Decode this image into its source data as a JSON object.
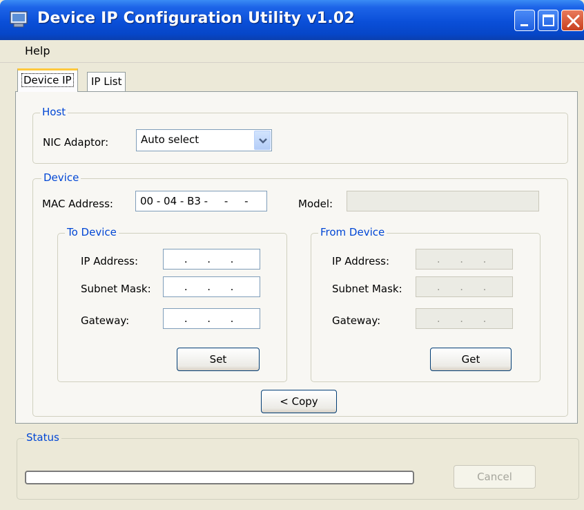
{
  "window": {
    "title": "Device IP Configuration Utility v1.02",
    "title_color": "#ffffff",
    "titlebar_color": "#0a4fd8"
  },
  "menu": {
    "items": [
      {
        "label": "Help"
      }
    ]
  },
  "tabs": [
    {
      "label": "Device IP",
      "active": true
    },
    {
      "label": "IP List",
      "active": false
    }
  ],
  "host": {
    "group_label": "Host",
    "nic_label": "NIC Adaptor:",
    "nic_value": "Auto select"
  },
  "device": {
    "group_label": "Device",
    "mac_label": "MAC Address:",
    "mac_value": "00 - 04 - B3 -     -     -",
    "model_label": "Model:",
    "model_value": ""
  },
  "to_device": {
    "group_label": "To Device",
    "ip_label": "IP Address:",
    "ip_value": "     .      .      .",
    "subnet_label": "Subnet Mask:",
    "subnet_value": "     .      .      .",
    "gateway_label": "Gateway:",
    "gateway_value": "     .      .      .",
    "set_label": "Set"
  },
  "from_device": {
    "group_label": "From Device",
    "ip_label": "IP Address:",
    "ip_value": "     .      .      .",
    "subnet_label": "Subnet Mask:",
    "subnet_value": "     .      .      .",
    "gateway_label": "Gateway:",
    "gateway_value": "     .      .      .",
    "get_label": "Get"
  },
  "copy_label": "< Copy",
  "status": {
    "group_label": "Status",
    "progress": 0,
    "cancel_label": "Cancel"
  },
  "colors": {
    "group_title": "#0046d5",
    "window_bg": "#ece9d8",
    "tab_highlight": "#ffc83c"
  },
  "icons": [
    "app-icon",
    "minimize-icon",
    "maximize-icon",
    "close-icon",
    "chevron-down-icon"
  ]
}
